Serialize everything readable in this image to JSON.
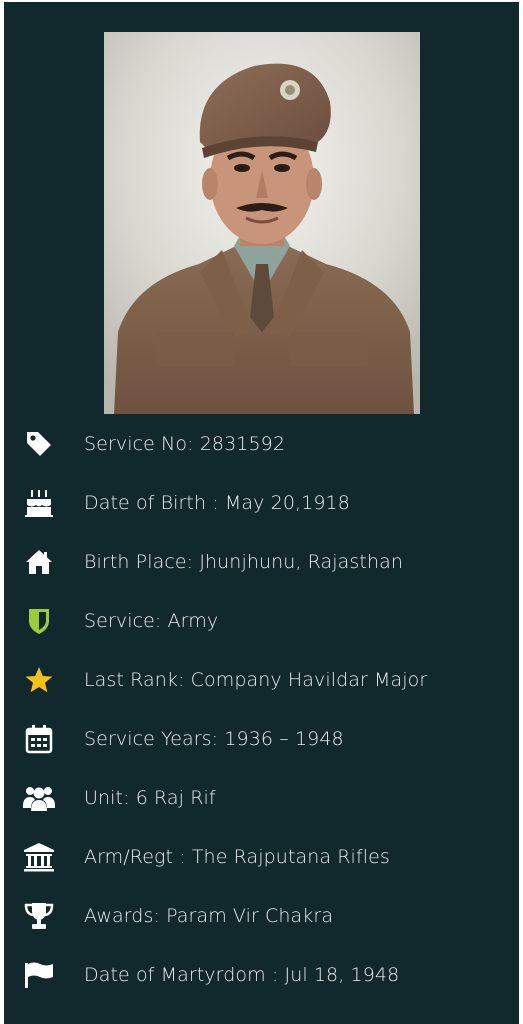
{
  "profile": {
    "items": [
      {
        "icon": "tag-icon",
        "text": "Service No: 2831592"
      },
      {
        "icon": "birthday-cake-icon",
        "text": "Date of Birth : May 20,1918"
      },
      {
        "icon": "home-icon",
        "text": "Birth Place: Jhunjhunu, Rajasthan"
      },
      {
        "icon": "shield-icon",
        "text": "Service: Army"
      },
      {
        "icon": "star-icon",
        "text": "Last Rank: Company Havildar Major"
      },
      {
        "icon": "calendar-icon",
        "text": "Service Years: 1936 – 1948"
      },
      {
        "icon": "users-icon",
        "text": "Unit: 6 Raj Rif"
      },
      {
        "icon": "institution-icon",
        "text": "Arm/Regt : The Rajputana Rifles"
      },
      {
        "icon": "trophy-icon",
        "text": "Awards: Param Vir Chakra"
      },
      {
        "icon": "flag-icon",
        "text": "Date of Martyrdom : Jul 18, 1948"
      }
    ]
  },
  "colors": {
    "background": "#11282d",
    "text": "#e6ecec",
    "icon": "#ffffff",
    "shield": "#9ccc3c",
    "star": "#f2c21b"
  }
}
